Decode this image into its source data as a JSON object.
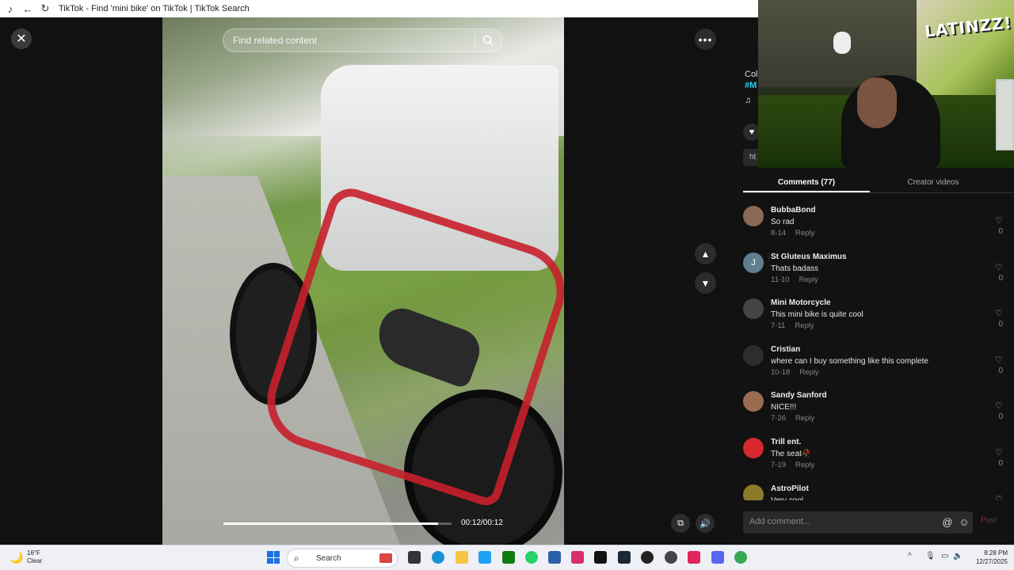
{
  "browser": {
    "title": "TikTok - Find 'mini bike' on TikTok | TikTok Search"
  },
  "viewer": {
    "search_placeholder": "Find related content",
    "time": "00:12/00:12",
    "progress_fraction": 0.94
  },
  "panel": {
    "peek_lines": [
      "Col",
      "#M",
      "♫"
    ],
    "link_peek": "ht",
    "tabs": [
      {
        "label": "Comments (77)",
        "active": true
      },
      {
        "label": "Creator videos",
        "active": false
      }
    ],
    "comments": [
      {
        "name": "BubbaBond",
        "text": "So rad",
        "date": "8-14",
        "reply": "Reply",
        "likes": "0",
        "avatar_initial": "",
        "avatar_color": "#8a6a55"
      },
      {
        "name": "St Gluteus Maximus",
        "text": "Thats badass",
        "date": "11-10",
        "reply": "Reply",
        "likes": "0",
        "avatar_initial": "J",
        "avatar_color": "#5f7e8f"
      },
      {
        "name": "Mini Motorcycle",
        "text": "This mini bike is quite cool",
        "date": "7-11",
        "reply": "Reply",
        "likes": "0",
        "avatar_initial": "",
        "avatar_color": "#444"
      },
      {
        "name": "Cristian",
        "text": "where can I buy something like this complete",
        "date": "10-18",
        "reply": "Reply",
        "likes": "0",
        "avatar_initial": "",
        "avatar_color": "#2d2d2d"
      },
      {
        "name": "Sandy Sanford",
        "text": "NICE!!!",
        "date": "7-26",
        "reply": "Reply",
        "likes": "0",
        "avatar_initial": "",
        "avatar_color": "#9a6c50"
      },
      {
        "name": "Trill ent.",
        "text": "The seat🥀",
        "date": "7-19",
        "reply": "Reply",
        "likes": "0",
        "avatar_initial": "",
        "avatar_color": "#d8282e"
      },
      {
        "name": "AstroPilot",
        "text": "Very cool",
        "date": "",
        "reply": "",
        "likes": "",
        "avatar_initial": "",
        "avatar_color": "#8c7a2a"
      }
    ],
    "comment_placeholder": "Add comment...",
    "post_label": "Post"
  },
  "webcam": {
    "mural_text": "LATINZZ!"
  },
  "taskbar": {
    "weather_temp": "16°F",
    "weather_desc": "Clear",
    "search_label": "Search",
    "time": "8:28 PM",
    "date": "12/27/2025"
  }
}
